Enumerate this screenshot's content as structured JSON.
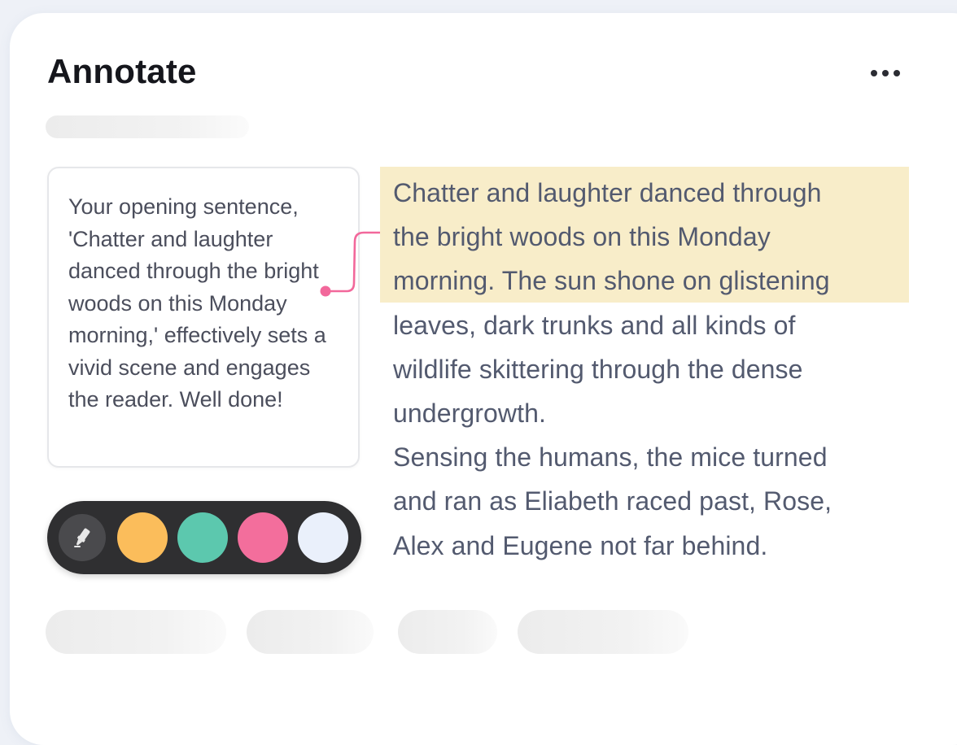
{
  "header": {
    "title": "Annotate",
    "more_icon": "more-horizontal-icon"
  },
  "comment": {
    "text": "Your opening sentence, 'Chatter and laughter danced through the bright woods on this Monday morning,' effectively sets a vivid scene and engages the reader. Well done!"
  },
  "connector": {
    "color": "#f2689b"
  },
  "palette": {
    "tool_icon": "highlighter-icon",
    "colors": [
      "#fbbd5b",
      "#5cc8ae",
      "#f36e9c",
      "#eaf0fb"
    ],
    "background": "#2f2f31"
  },
  "essay": {
    "highlight_color": "#f8edc9",
    "lines": [
      "Chatter and laughter danced through",
      "the bright woods on this Monday",
      "morning. The sun shone on glistening",
      "leaves, dark trunks and all kinds of",
      "wildlife skittering through the dense",
      "undergrowth.",
      "Sensing the humans, the mice turned",
      "and ran as Eliabeth raced past, Rose,",
      "Alex and Eugene not far behind."
    ]
  }
}
